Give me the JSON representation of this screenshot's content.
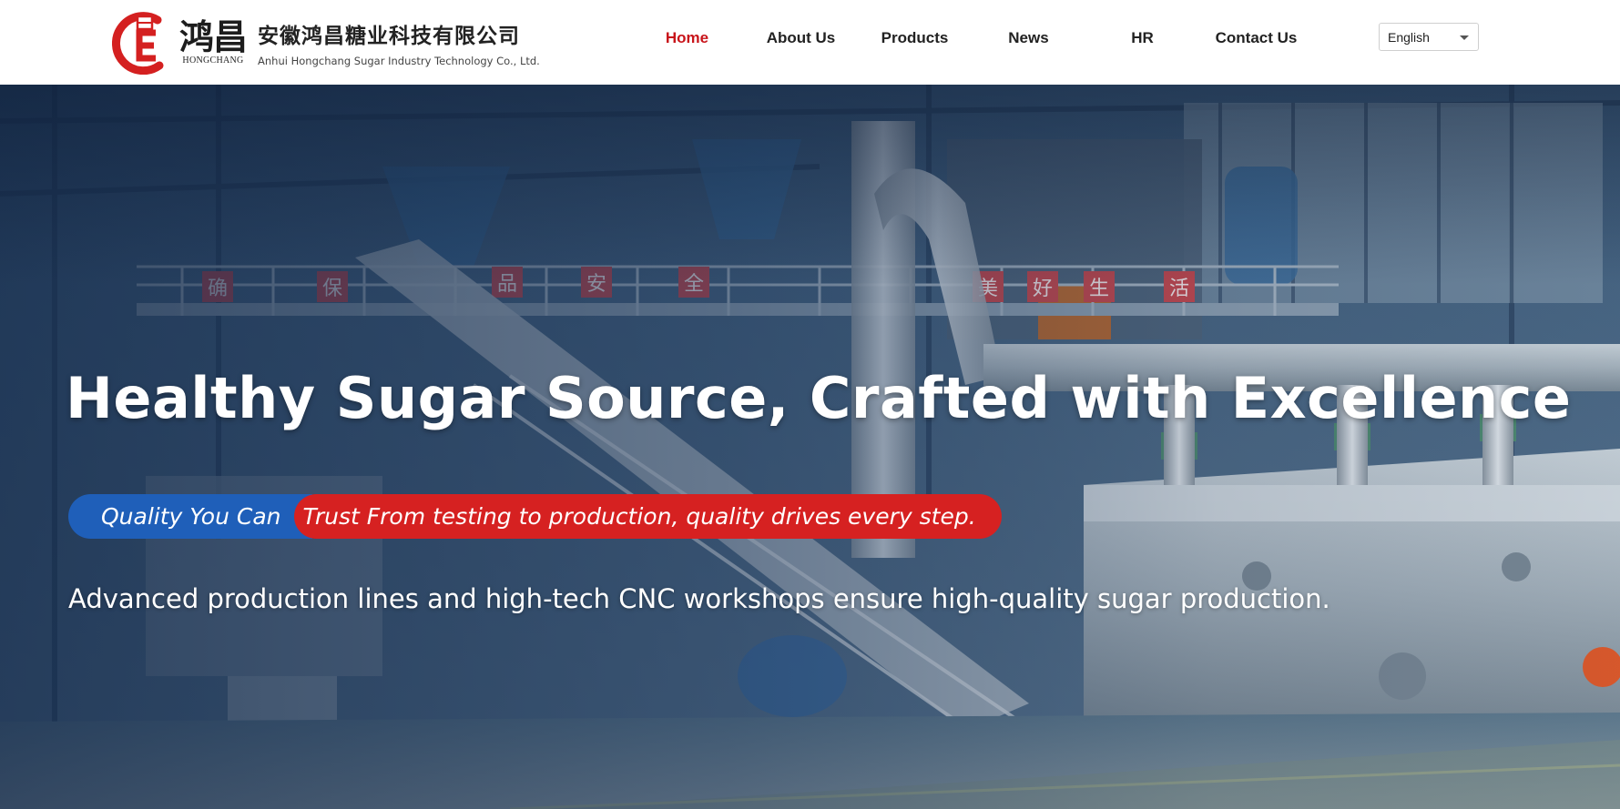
{
  "header": {
    "logo": {
      "brand_cn": "鸿昌",
      "brand_en": "HONGCHANG",
      "mark_letters": "E",
      "mark_small": "日",
      "brand_color": "#d42020"
    },
    "company_cn": "安徽鸿昌糖业科技有限公司",
    "company_en": "Anhui Hongchang Sugar Industry Technology Co., Ltd."
  },
  "nav": {
    "items": [
      {
        "label": "Home",
        "active": true
      },
      {
        "label": "About Us",
        "active": false
      },
      {
        "label": "Products",
        "active": false
      },
      {
        "label": "News",
        "active": false
      },
      {
        "label": "HR",
        "active": false
      },
      {
        "label": "Contact Us",
        "active": false
      }
    ],
    "active_color": "#c8141a"
  },
  "language": {
    "selected": "English",
    "icon": "chevron-down-icon"
  },
  "hero": {
    "title": "Healthy Sugar Source, Crafted with Excellence",
    "tag_blue": "Quality You Can",
    "tag_red": "Trust From testing to production, quality drives every step.",
    "subtitle": "Advanced production lines and high-tech CNC workshops ensure high-quality sugar production.",
    "tag_blue_color": "#1f5fb9",
    "tag_red_color": "#d62121",
    "background_signs": [
      "确",
      "保",
      "品",
      "安",
      "全",
      "美",
      "好",
      "生",
      "活"
    ]
  }
}
